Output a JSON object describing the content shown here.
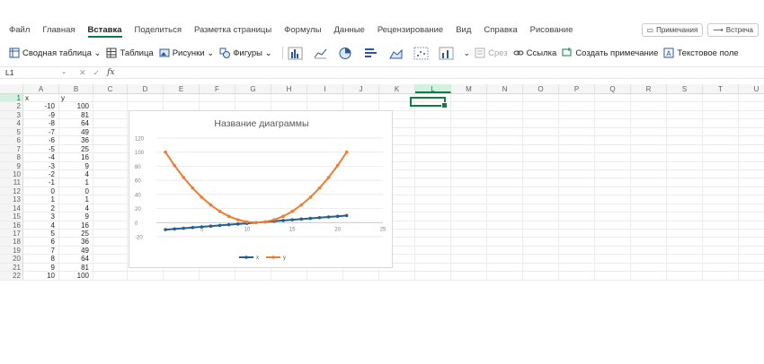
{
  "menu": {
    "tabs": [
      "Файл",
      "Главная",
      "Вставка",
      "Поделиться",
      "Разметка страницы",
      "Формулы",
      "Данные",
      "Рецензирование",
      "Вид",
      "Справка",
      "Рисование"
    ],
    "active_tab": "Вставка",
    "comments_button": "Примечания",
    "meeting_button": "Встреча"
  },
  "toolbar": {
    "pivot": "Сводная таблица",
    "table": "Таблица",
    "pictures": "Рисунки",
    "shapes": "Фигуры",
    "slicer": "Срез",
    "link": "Ссылка",
    "add_comment": "Создать примечание",
    "textbox": "Текстовое поле"
  },
  "formula_bar": {
    "name_box": "L1",
    "fx_label": "fx",
    "value": ""
  },
  "columns": [
    "A",
    "B",
    "C",
    "D",
    "E",
    "F",
    "G",
    "H",
    "I",
    "J",
    "K",
    "L",
    "M",
    "N",
    "O",
    "P",
    "Q",
    "R",
    "S",
    "T",
    "U"
  ],
  "selected_column": "L",
  "selected_row": "1",
  "sheet": {
    "header": [
      "x",
      "y"
    ],
    "x": [
      -10,
      -9,
      -8,
      -7,
      -6,
      -5,
      -4,
      -3,
      -2,
      -1,
      0,
      1,
      2,
      3,
      4,
      5,
      6,
      7,
      8,
      9,
      10
    ],
    "y": [
      100,
      81,
      64,
      49,
      36,
      25,
      16,
      9,
      4,
      1,
      0,
      1,
      4,
      9,
      16,
      25,
      36,
      49,
      64,
      81,
      100
    ]
  },
  "chart_data": {
    "type": "line",
    "title": "Название диаграммы",
    "x": [
      1,
      2,
      3,
      4,
      5,
      6,
      7,
      8,
      9,
      10,
      11,
      12,
      13,
      14,
      15,
      16,
      17,
      18,
      19,
      20,
      21
    ],
    "series": [
      {
        "name": "x",
        "values": [
          -10,
          -9,
          -8,
          -7,
          -6,
          -5,
          -4,
          -3,
          -2,
          -1,
          0,
          1,
          2,
          3,
          4,
          5,
          6,
          7,
          8,
          9,
          10
        ],
        "color": "#255e91"
      },
      {
        "name": "y",
        "values": [
          100,
          81,
          64,
          49,
          36,
          25,
          16,
          9,
          4,
          1,
          0,
          1,
          4,
          9,
          16,
          25,
          36,
          49,
          64,
          81,
          100
        ],
        "color": "#ed7d31"
      }
    ],
    "yticks": [
      120,
      100,
      80,
      60,
      40,
      20,
      0,
      -20
    ],
    "xticks": [
      5,
      10,
      15,
      20,
      25
    ],
    "ylim": [
      -20,
      120
    ],
    "xlim": [
      0,
      25
    ],
    "legend": "bottom",
    "grid": true
  }
}
